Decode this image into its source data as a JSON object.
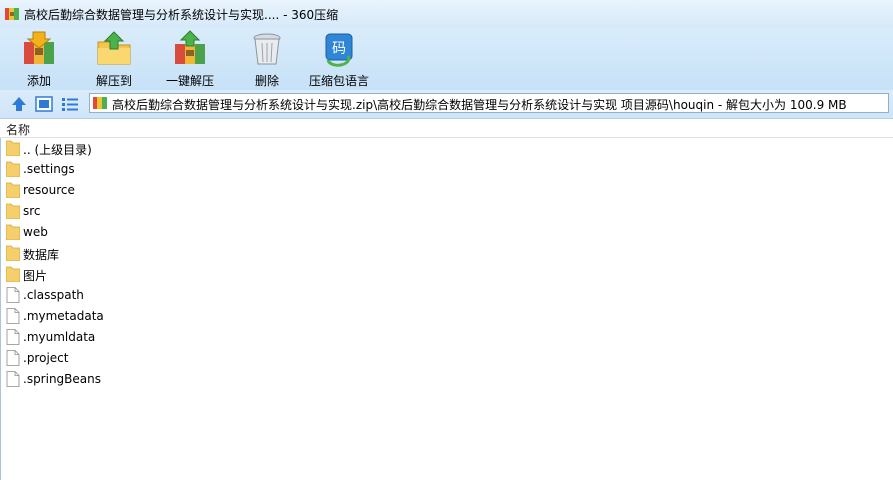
{
  "window": {
    "title": "高校后勤综合数据管理与分析系统设计与实现.... - 360压缩"
  },
  "toolbar": {
    "buttons": [
      {
        "label": "添加",
        "icon": "add-archive-icon"
      },
      {
        "label": "解压到",
        "icon": "extract-to-icon"
      },
      {
        "label": "一键解压",
        "icon": "one-click-extract-icon"
      },
      {
        "label": "删除",
        "icon": "delete-bin-icon"
      },
      {
        "label": "压缩包语言",
        "icon": "archive-language-icon"
      }
    ]
  },
  "address": {
    "path": "高校后勤综合数据管理与分析系统设计与实现.zip\\高校后勤综合数据管理与分析系统设计与实现 项目源码\\houqin - 解包大小为 100.9 MB"
  },
  "list": {
    "header": "名称",
    "items": [
      {
        "name": ".. (上级目录)",
        "type": "folder"
      },
      {
        "name": ".settings",
        "type": "folder"
      },
      {
        "name": "resource",
        "type": "folder"
      },
      {
        "name": "src",
        "type": "folder"
      },
      {
        "name": "web",
        "type": "folder"
      },
      {
        "name": "数据库",
        "type": "folder"
      },
      {
        "name": "图片",
        "type": "folder"
      },
      {
        "name": ".classpath",
        "type": "file"
      },
      {
        "name": ".mymetadata",
        "type": "file"
      },
      {
        "name": ".myumldata",
        "type": "file"
      },
      {
        "name": ".project",
        "type": "file"
      },
      {
        "name": ".springBeans",
        "type": "file"
      }
    ]
  },
  "colors": {
    "folder": "#f5cf6b",
    "accent": "#2e7bd6"
  }
}
